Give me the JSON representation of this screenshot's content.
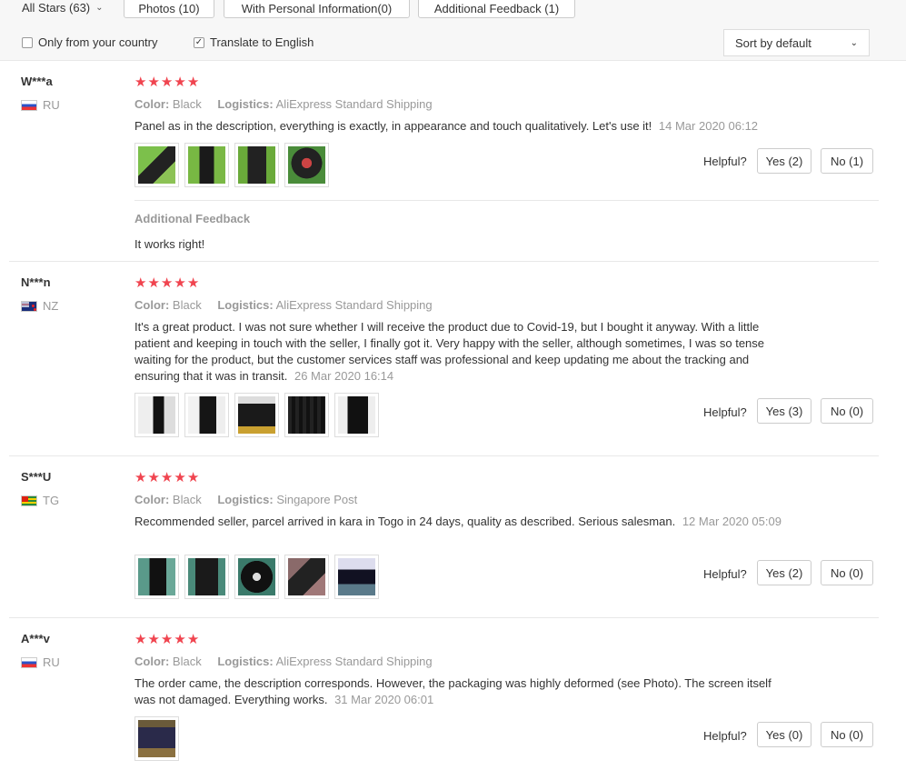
{
  "filters": {
    "all_stars": "All Stars (63)",
    "photos": "Photos (10)",
    "personal_info": "With Personal Information(0)",
    "additional_feedback": "Additional Feedback (1)",
    "only_country": "Only from your country",
    "translate": "Translate to English",
    "sort": "Sort by default"
  },
  "labels": {
    "color": "Color:",
    "logistics": "Logistics:",
    "helpful": "Helpful?",
    "additional_feedback": "Additional Feedback"
  },
  "reviews": [
    {
      "user": "W***a",
      "country": "RU",
      "rating": 5,
      "color": "Black",
      "logistics": "AliExpress Standard Shipping",
      "text": "Panel as in the description, everything is exactly, in appearance and touch qualitatively. Let's use it!",
      "date": "14 Mar 2020 06:12",
      "yes": "Yes (2)",
      "no": "No (1)",
      "additional_feedback": "It works right!"
    },
    {
      "user": "N***n",
      "country": "NZ",
      "rating": 5,
      "color": "Black",
      "logistics": "AliExpress Standard Shipping",
      "text": "It's a great product. I was not sure whether I will receive the product due to Covid-19, but I bought it anyway. With a little patient and keeping in touch with the seller, I finally got it. Very happy with the seller, although sometimes, I was so tense waiting for the product, but the customer services staff was professional and keep updating me about the tracking and ensuring that it was in transit.",
      "date": "26 Mar 2020 16:14",
      "yes": "Yes (3)",
      "no": "No (0)"
    },
    {
      "user": "S***U",
      "country": "TG",
      "rating": 5,
      "color": "Black",
      "logistics": "Singapore Post",
      "text": "Recommended seller, parcel arrived in kara in Togo in 24 days, quality as described. Serious salesman.",
      "date": "12 Mar 2020 05:09",
      "yes": "Yes (2)",
      "no": "No (0)"
    },
    {
      "user": "A***v",
      "country": "RU",
      "rating": 5,
      "color": "Black",
      "logistics": "AliExpress Standard Shipping",
      "text": "The order came, the description corresponds. However, the packaging was highly deformed (see Photo). The screen itself was not damaged. Everything works.",
      "date": "31 Mar 2020 06:01",
      "yes": "Yes (0)",
      "no": "No (0)"
    }
  ]
}
